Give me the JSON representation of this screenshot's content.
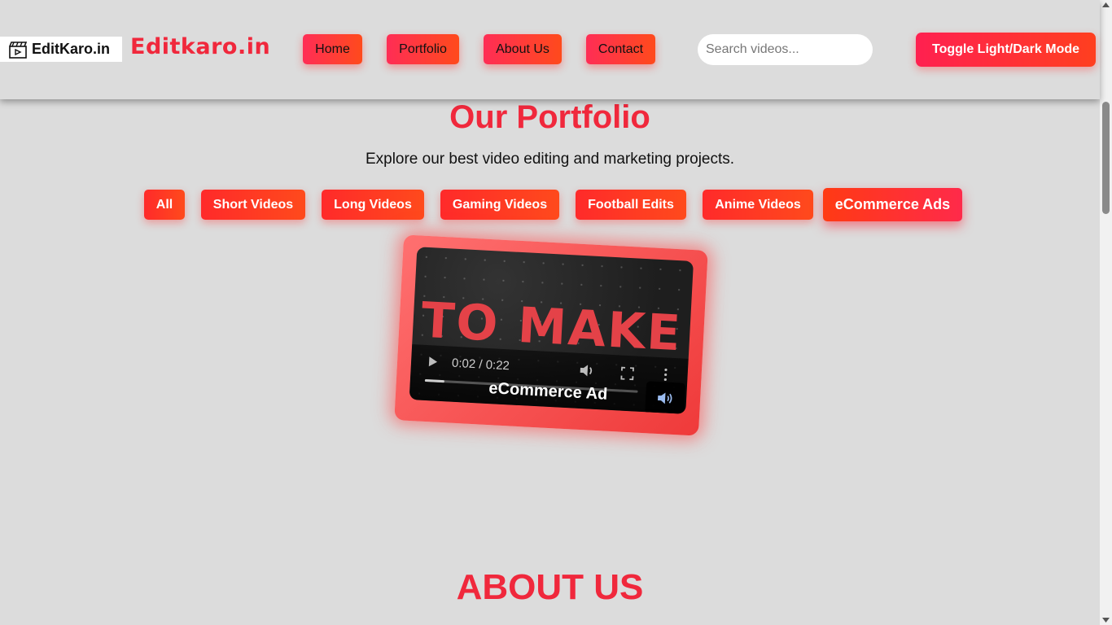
{
  "header": {
    "logo_text": "EditKaro.in",
    "brand": "Editkaro.in",
    "nav": [
      {
        "label": "Home"
      },
      {
        "label": "Portfolio"
      },
      {
        "label": "About Us"
      },
      {
        "label": "Contact"
      }
    ],
    "search_placeholder": "Search videos...",
    "toggle_label": "Toggle Light/Dark Mode"
  },
  "portfolio": {
    "title": "Our Portfolio",
    "subtitle": "Explore our best video editing and marketing projects.",
    "filters": [
      {
        "label": "All"
      },
      {
        "label": "Short Videos"
      },
      {
        "label": "Long Videos"
      },
      {
        "label": "Gaming Videos"
      },
      {
        "label": "Football Edits"
      },
      {
        "label": "Anime Videos"
      },
      {
        "label": "eCommerce Ads"
      }
    ],
    "active_filter": "eCommerce Ads",
    "video": {
      "frame_text": "TO MAKE",
      "time": "0:02 / 0:22",
      "progress": 0.09,
      "label": "eCommerce Ad"
    }
  },
  "about": {
    "title": "ABOUT US"
  },
  "colors": {
    "brand_red": "#f0283c",
    "button_gradient_start": "#ff2d55",
    "button_gradient_end": "#ff4a1c",
    "background": "#dcdcdc"
  }
}
